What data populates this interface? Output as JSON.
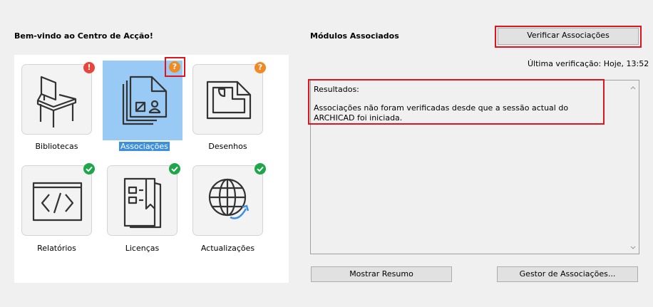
{
  "left": {
    "title": "Bem-vindo ao Centro de Acção!",
    "tiles": [
      {
        "label": "Bibliotecas",
        "icon": "chair-icon",
        "status": "error",
        "badge": "!"
      },
      {
        "label": "Associações",
        "icon": "hotlink-files-icon",
        "status": "warning",
        "badge": "?"
      },
      {
        "label": "Desenhos",
        "icon": "drawing-icon",
        "status": "warning",
        "badge": "?"
      },
      {
        "label": "Relatórios",
        "icon": "code-icon",
        "status": "ok",
        "badge": "check"
      },
      {
        "label": "Licenças",
        "icon": "license-icon",
        "status": "ok",
        "badge": "check"
      },
      {
        "label": "Actualizações",
        "icon": "globe-update-icon",
        "status": "ok",
        "badge": "check"
      }
    ]
  },
  "right": {
    "title": "Módulos Associados",
    "check_button": "Verificar Associações",
    "last_check": "Última verificação: Hoje, 13:52",
    "results_heading": "Resultados:",
    "results_text": "Associações não foram verificadas desde que a sessão actual do ARCHICAD foi iniciada.",
    "summary_button": "Mostrar Resumo",
    "manager_button": "Gestor de Associações..."
  },
  "colors": {
    "error": "#e8453c",
    "warning": "#f08a24",
    "ok": "#1fa64a",
    "selection": "#99c9f5",
    "highlight": "#e0141e"
  }
}
